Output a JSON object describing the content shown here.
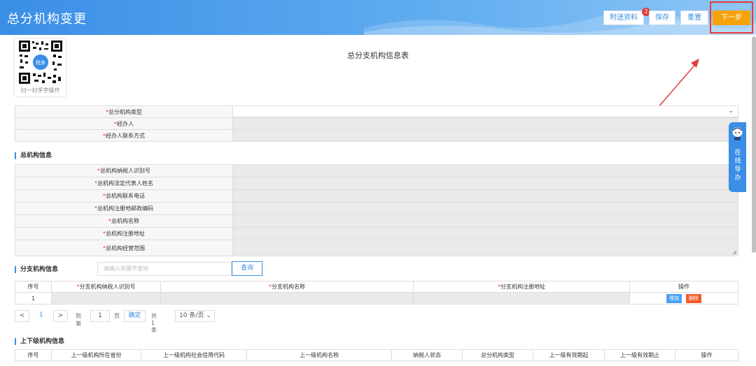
{
  "header": {
    "title": "总分机构变更",
    "buttons": {
      "attachments": "附送资料",
      "save": "保存",
      "reset": "重置",
      "next": "下一步"
    },
    "badge_count": "2"
  },
  "qr": {
    "caption": "扫一扫手字操作",
    "logo_text": "税务"
  },
  "form_title": "总分支机构信息表",
  "top_fields": [
    {
      "label": "总分机构类型",
      "required": true
    },
    {
      "label": "经办人",
      "required": true
    },
    {
      "label": "经办人联系方式",
      "required": true
    }
  ],
  "select_chevron": "⌄",
  "sections": {
    "head_org": "总机构信息",
    "branch": "分支机构信息",
    "superior": "上下级机构信息"
  },
  "head_org_fields": [
    {
      "label": "总机构纳税人识别号",
      "required": true
    },
    {
      "label": "总机构法定代表人姓名",
      "required": true
    },
    {
      "label": "总机构联系电话",
      "required": true
    },
    {
      "label": "总机构注册地邮政编码",
      "required": true
    },
    {
      "label": "总机构名称",
      "required": true
    },
    {
      "label": "总机构注册地址",
      "required": true
    },
    {
      "label": "总机构经营范围",
      "required": true
    }
  ],
  "branch_search": {
    "placeholder": "请输入关键字查询",
    "button": "查询"
  },
  "branch_table": {
    "headers": [
      "序号",
      "分支机构纳税人识别号",
      "分支机构名称",
      "分支机构注册地址",
      "操作"
    ],
    "required": [
      false,
      true,
      true,
      true,
      false
    ],
    "rows": [
      {
        "index": "1",
        "add": "增加",
        "delete": "删除"
      }
    ]
  },
  "pager": {
    "prev": "<",
    "page": "1",
    "next": ">",
    "goto_label": "到第",
    "goto_value": "1",
    "page_unit": "页",
    "confirm": "确定",
    "total": "共 1 条",
    "page_size": "10 条/页",
    "page_size_chevron": "⌄"
  },
  "superior_table": {
    "headers": [
      "序号",
      "上一级机构所在省份",
      "上一级机构社会信用代码",
      "上一级机构名称",
      "纳税人状态",
      "总分机构类型",
      "上一级有效期起",
      "上一级有效期止",
      "操作"
    ]
  },
  "side_tab": {
    "text": "在线导办"
  },
  "colors": {
    "brand": "#3a8ee6",
    "next": "#f5a20b",
    "required": "#e5393b",
    "delete": "#f55b2a"
  }
}
